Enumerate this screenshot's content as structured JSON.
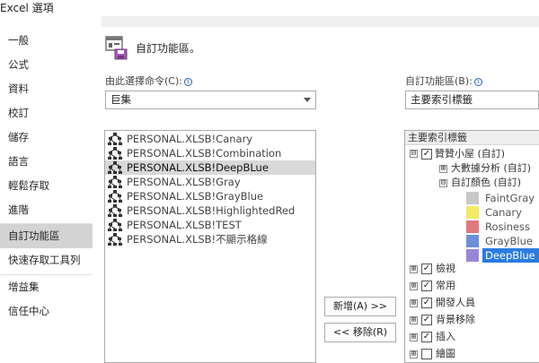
{
  "window": {
    "title": "Excel 選項"
  },
  "nav": {
    "items": [
      {
        "label": "一般"
      },
      {
        "label": "公式"
      },
      {
        "label": "資料"
      },
      {
        "label": "校訂"
      },
      {
        "label": "儲存"
      },
      {
        "label": "語言"
      },
      {
        "label": "輕鬆存取"
      },
      {
        "label": "進階"
      },
      {
        "label": "自訂功能區"
      },
      {
        "label": "快速存取工具列"
      },
      {
        "label": "增益集"
      },
      {
        "label": "信任中心"
      }
    ],
    "selected_index": 8
  },
  "header": {
    "title": "自訂功能區。"
  },
  "left_panel": {
    "label": "由此選擇命令(C):",
    "dropdown_value": "巨集",
    "commands": [
      {
        "label": "PERSONAL.XLSB!Canary"
      },
      {
        "label": "PERSONAL.XLSB!Combination"
      },
      {
        "label": "PERSONAL.XLSB!DeepBLue"
      },
      {
        "label": "PERSONAL.XLSB!Gray"
      },
      {
        "label": "PERSONAL.XLSB!GrayBlue"
      },
      {
        "label": "PERSONAL.XLSB!HighlightedRed"
      },
      {
        "label": "PERSONAL.XLSB!TEST"
      },
      {
        "label": "PERSONAL.XLSB!不顯示格線"
      }
    ],
    "selected_index": 2
  },
  "buttons": {
    "add": "新增(A) >>",
    "remove": "<< 移除(R)"
  },
  "right_panel": {
    "label": "自訂功能區(B):",
    "dropdown_value": "主要索引標籤",
    "tree_header": "主要索引標籤",
    "tabs_top": {
      "expander": "⊟",
      "label": "贊贊小屋 (自訂)",
      "checked": true
    },
    "group_big": {
      "expander": "⊞",
      "label": "大數據分析 (自訂)"
    },
    "group_color": {
      "expander": "⊟",
      "label": "自訂顏色 (自訂)"
    },
    "colors": [
      {
        "label": "FaintGray",
        "color": "#c8c8c8"
      },
      {
        "label": "Canary",
        "color": "#f4ea64"
      },
      {
        "label": "Rosiness",
        "color": "#e07880"
      },
      {
        "label": "GrayBlue",
        "color": "#6c8fd8"
      },
      {
        "label": "DeepBlue",
        "color": "#9a86d8"
      }
    ],
    "selected_color_index": 4,
    "tabs": [
      {
        "label": "檢視",
        "checked": true
      },
      {
        "label": "常用",
        "checked": true
      },
      {
        "label": "開發人員",
        "checked": true
      },
      {
        "label": "背景移除",
        "checked": true
      },
      {
        "label": "插入",
        "checked": true
      },
      {
        "label": "繪圖",
        "checked": false
      }
    ]
  },
  "colors": {
    "selected_highlight": "#2b7be0",
    "nav_selected": "#d3d3d3"
  }
}
